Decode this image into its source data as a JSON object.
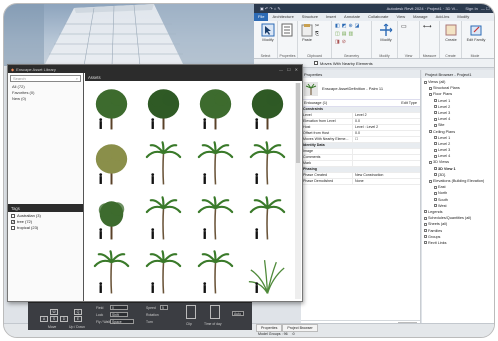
{
  "revit": {
    "title_text": "Autodesk Revit 2024 · Project1 · 3D Vi...",
    "signin": "Sign In",
    "tabs": [
      "File",
      "Architecture",
      "Structure",
      "Insert",
      "Annotate",
      "Collaborate",
      "View",
      "Manage",
      "Add-Ins",
      "Modify"
    ],
    "active_tab": "File",
    "ribbon_groups": {
      "select": "Select",
      "properties": "Properties",
      "clipboard": "Clipboard",
      "geometry": "Geometry",
      "modify": "Modify",
      "view": "View",
      "measure": "Measure",
      "create": "Create",
      "mode": "Mode"
    },
    "modify_label": "Modify",
    "paste_label": "Paste",
    "cut_label": "Cut",
    "join_label": "Join",
    "create_label": "Create",
    "edit_family_label": "Edit Family",
    "options_checkbox": "Moves With Nearby Elements"
  },
  "properties": {
    "header": "Properties",
    "type_name": "Enscape AssetDefinition - Palm 11",
    "filter_value": "Entourage (1)",
    "edit_type": "Edit Type",
    "rows": [
      {
        "k": "Constraints",
        "v": "",
        "section": true
      },
      {
        "k": "Level",
        "v": "Level 2"
      },
      {
        "k": "Elevation from Level",
        "v": "0.0"
      },
      {
        "k": "Host",
        "v": "Level : Level 2"
      },
      {
        "k": "Offset from Host",
        "v": "0.0"
      },
      {
        "k": "Moves With Nearby Eleme...",
        "v": "☐"
      },
      {
        "k": "Identity Data",
        "v": "",
        "section": true
      },
      {
        "k": "Image",
        "v": ""
      },
      {
        "k": "Comments",
        "v": ""
      },
      {
        "k": "Mark",
        "v": ""
      },
      {
        "k": "Phasing",
        "v": "",
        "section": true
      },
      {
        "k": "Phase Created",
        "v": "New Construction"
      },
      {
        "k": "Phase Demolished",
        "v": "None"
      }
    ],
    "help_link": "Properties help",
    "apply": "Apply"
  },
  "browser": {
    "header": "Project Browser - Project1",
    "tree": [
      {
        "t": "Views (all)",
        "d": 0,
        "b": true
      },
      {
        "t": "Structural Plans",
        "d": 1
      },
      {
        "t": "Floor Plans",
        "d": 1
      },
      {
        "t": "Level 1",
        "d": 2
      },
      {
        "t": "Level 2",
        "d": 2
      },
      {
        "t": "Level 3",
        "d": 2
      },
      {
        "t": "Level 4",
        "d": 2
      },
      {
        "t": "Site",
        "d": 2
      },
      {
        "t": "Ceiling Plans",
        "d": 1
      },
      {
        "t": "Level 1",
        "d": 2
      },
      {
        "t": "Level 2",
        "d": 2
      },
      {
        "t": "Level 3",
        "d": 2
      },
      {
        "t": "Level 4",
        "d": 2
      },
      {
        "t": "3D Views",
        "d": 1
      },
      {
        "t": "3D View 1",
        "d": 2,
        "bold": true
      },
      {
        "t": "{3D}",
        "d": 2
      },
      {
        "t": "Elevations (Building Elevation)",
        "d": 1
      },
      {
        "t": "East",
        "d": 2
      },
      {
        "t": "North",
        "d": 2
      },
      {
        "t": "South",
        "d": 2
      },
      {
        "t": "West",
        "d": 2
      },
      {
        "t": "Legends",
        "d": 0
      },
      {
        "t": "Schedules/Quantities (all)",
        "d": 0
      },
      {
        "t": "Sheets (all)",
        "d": 0
      },
      {
        "t": "Families",
        "d": 0
      },
      {
        "t": "Groups",
        "d": 0
      },
      {
        "t": "Revit Links",
        "d": 0
      }
    ]
  },
  "status": {
    "prop_tab": "Properties",
    "browser_tab": "Project Browser",
    "model_groups": "Model Groups : 96",
    "zero": ":0"
  },
  "asset_library": {
    "title": "Enscape Asset Library",
    "search_placeholder": "Search",
    "categories": [
      "All (72)",
      "Favorites (0)",
      "New (0)"
    ],
    "tags_header": "Tags",
    "tags": [
      {
        "label": "Australian (3)",
        "checked": false
      },
      {
        "label": "tree (72)",
        "checked": true
      },
      {
        "label": "tropical (23)",
        "checked": false
      }
    ],
    "assets_header": "Assets"
  },
  "controls": {
    "keys": [
      "W",
      "A",
      "S",
      "D",
      "Q",
      "E"
    ],
    "labels": [
      "Move",
      "Up / Down"
    ],
    "fov": "Field",
    "fov_val": "0",
    "lock": "Lock",
    "lock_val": "Shift",
    "fly": "Fly / Walk",
    "fly_key": "Space",
    "speed": "Speed",
    "speed_val": "5",
    "rotation": "Rotation",
    "turn": "Turn",
    "auto": "Auto",
    "clip": "Clip",
    "timeofday": "Time of day"
  }
}
